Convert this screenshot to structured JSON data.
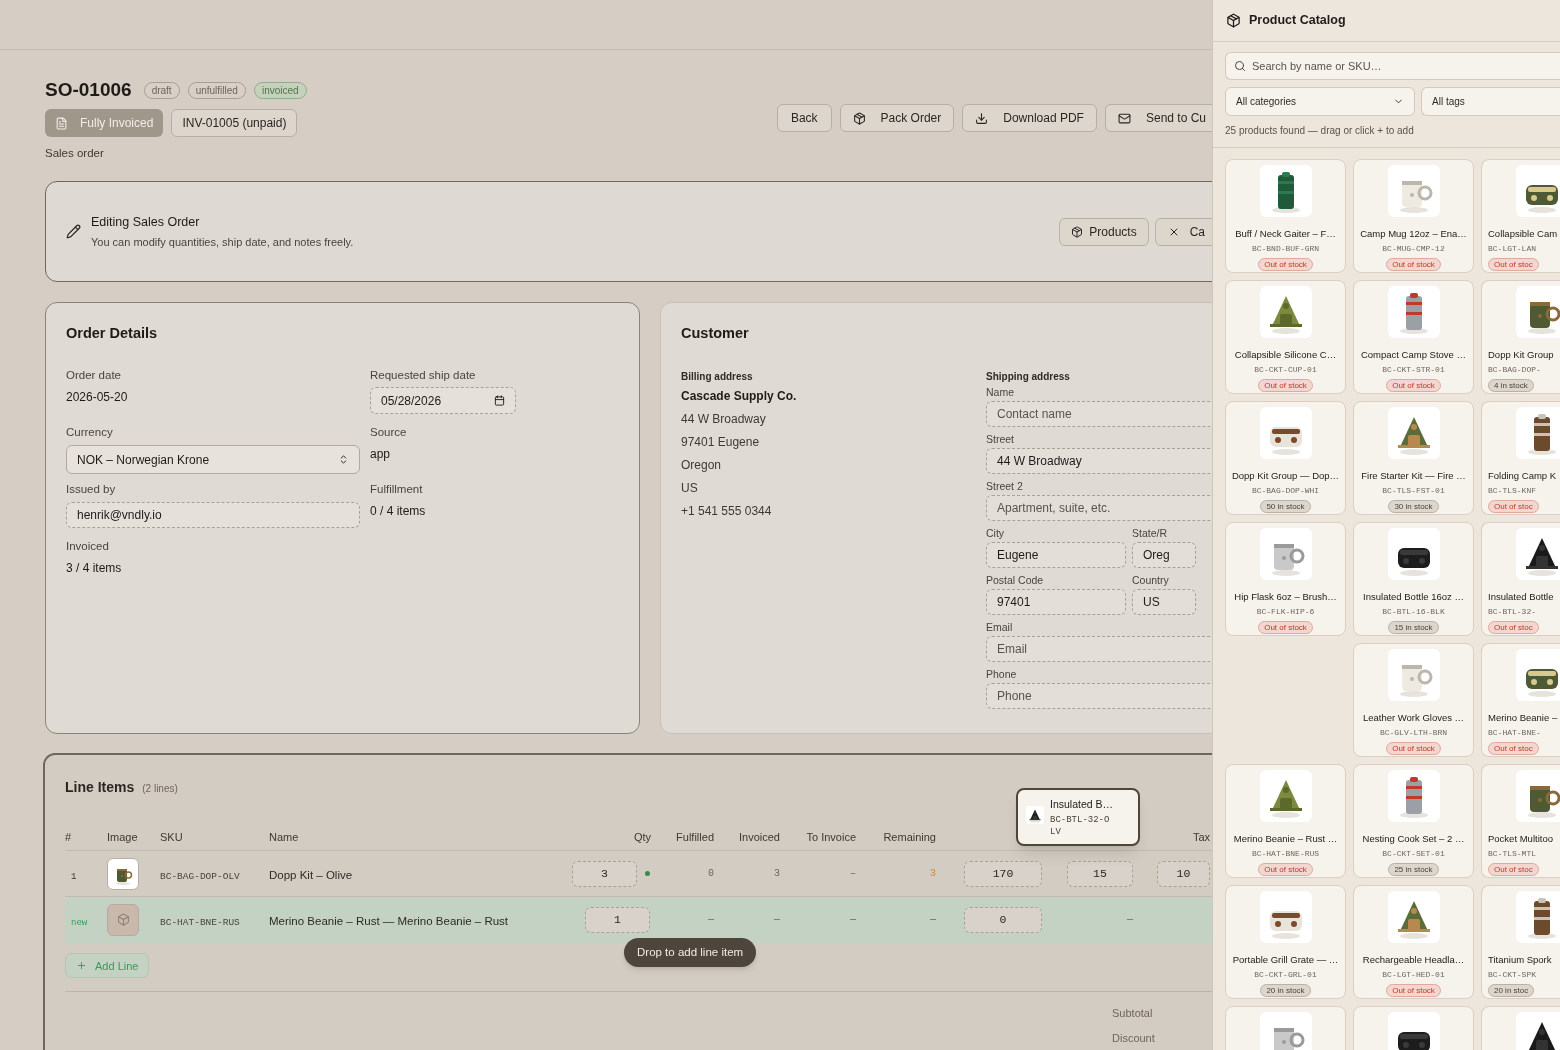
{
  "header": {
    "title": "SO-01006",
    "badges": [
      {
        "label": "draft",
        "kind": "neutral"
      },
      {
        "label": "unfulfilled",
        "kind": "neutral"
      },
      {
        "label": "invoiced",
        "kind": "success"
      }
    ],
    "status_button": "Fully Invoiced",
    "invoice_button": "INV-01005 (unpaid)",
    "subtitle": "Sales order",
    "actions": [
      "Back",
      "Pack Order",
      "Download PDF",
      "Send to Cu"
    ]
  },
  "banner": {
    "title": "Editing Sales Order",
    "text": "You can modify quantities, ship date, and notes freely.",
    "buttons": [
      "Products",
      "Ca"
    ]
  },
  "order_details": {
    "title": "Order Details",
    "fields": [
      {
        "label": "Order date",
        "kind": "text",
        "value": "2026-05-20"
      },
      {
        "label": "Requested ship date",
        "kind": "date",
        "value": "05/28/2026"
      },
      {
        "label": "Currency",
        "kind": "select",
        "value": "NOK – Norwegian Krone"
      },
      {
        "label": "Source",
        "kind": "text",
        "value": "app"
      },
      {
        "label": "Issued by",
        "kind": "input",
        "value": "henrik@vndly.io"
      },
      {
        "label": "Fulfillment",
        "kind": "text",
        "value": "0 / 4 items"
      },
      {
        "label": "Invoiced",
        "kind": "text",
        "value": "3 / 4 items"
      }
    ]
  },
  "customer": {
    "title": "Customer",
    "billing": {
      "label": "Billing address",
      "company": "Cascade Supply Co.",
      "lines": [
        "44 W Broadway",
        "97401 Eugene",
        "Oregon",
        "US",
        "+1 541 555 0344"
      ]
    },
    "shipping": {
      "label": "Shipping address",
      "fields": [
        {
          "label": "Name",
          "placeholder": "Contact name"
        },
        {
          "label": "Street",
          "value": "44 W Broadway"
        },
        {
          "label": "Street 2",
          "placeholder": "Apartment, suite, etc."
        },
        {
          "label": "City",
          "value": "Eugene"
        },
        {
          "label": "State/R",
          "value": "Oreg"
        },
        {
          "label": "Postal Code",
          "value": "97401"
        },
        {
          "label": "Country",
          "value": "US"
        },
        {
          "label": "Email",
          "placeholder": "Email"
        },
        {
          "label": "Phone",
          "placeholder": "Phone"
        }
      ]
    }
  },
  "line_items": {
    "title": "Line Items",
    "count": "(2 lines)",
    "columns": [
      "#",
      "Image",
      "SKU",
      "Name",
      "Qty",
      "Fulfilled",
      "Invoiced",
      "To Invoice",
      "Remaining",
      "Tax"
    ],
    "rows": [
      {
        "kind": "existing",
        "index": "1",
        "sku": "BC-BAG-DOP-OLV",
        "name": "Dopp Kit – Olive",
        "qty": "3",
        "fulfilled": "0",
        "invoiced": "3",
        "to_invoice": "–",
        "remaining": "3",
        "price": "170",
        "discount": "15",
        "tax": "10"
      },
      {
        "kind": "new",
        "index": "new",
        "sku": "BC-HAT-BNE-RUS",
        "name": "Merino Beanie – Rust — Merino Beanie – Rust",
        "qty": "1",
        "fulfilled": "—",
        "invoiced": "—",
        "to_invoice": "—",
        "remaining": "—",
        "price": "0",
        "discount": "—"
      }
    ],
    "add_button": "Add Line",
    "drop_hint": "Drop to add line item",
    "drag_item": {
      "name": "Insulated B…",
      "sku": "BC-BTL-32-OLV"
    },
    "totals": [
      "Subtotal",
      "Discount"
    ]
  },
  "panel": {
    "title": "Product Catalog",
    "search": {
      "placeholder": "Search by name or SKU…"
    },
    "filters": [
      "All categories",
      "All tags"
    ],
    "count": "25 products found — drag or click + to add",
    "products": [
      {
        "kind": "card",
        "name": "Buff / Neck Gaiter – F…",
        "sku": "BC-BND-BUF-GRN",
        "stock": "Out of stock",
        "out": true
      },
      {
        "kind": "card",
        "name": "Camp Mug 12oz – Ena…",
        "sku": "BC-MUG-CMP-12",
        "stock": "Out of stock",
        "out": true
      },
      {
        "kind": "card",
        "name": "Collapsible Cam",
        "sku": "BC-LGT-LAN",
        "stock": "Out of stoc",
        "out": true
      },
      {
        "kind": "card",
        "name": "Collapsible Silicone C…",
        "sku": "BC-CKT-CUP-01",
        "stock": "Out of stock",
        "out": true
      },
      {
        "kind": "card",
        "name": "Compact Camp Stove …",
        "sku": "BC-CKT-STR-01",
        "stock": "Out of stock",
        "out": true
      },
      {
        "kind": "card",
        "name": "Dopp Kit Group",
        "sku": "BC-BAG-DOP-",
        "stock": "4 in stock",
        "out": false
      },
      {
        "kind": "card",
        "name": "Dopp Kit Group — Dop…",
        "sku": "BC-BAG-DOP-WHI",
        "stock": "50 in stock",
        "out": false
      },
      {
        "kind": "card",
        "name": "Fire Starter Kit — Fire …",
        "sku": "BC-TLS-FST-01",
        "stock": "30 in stock",
        "out": false
      },
      {
        "kind": "card",
        "name": "Folding Camp K",
        "sku": "BC-TLS-KNF",
        "stock": "Out of stoc",
        "out": true
      },
      {
        "kind": "card",
        "name": "Hip Flask 6oz – Brush…",
        "sku": "BC-FLK-HIP-6",
        "stock": "Out of stock",
        "out": true
      },
      {
        "kind": "card",
        "name": "Insulated Bottle 16oz …",
        "sku": "BC-BTL-16-BLK",
        "stock": "15 in stock",
        "out": false
      },
      {
        "kind": "card",
        "name": "Insulated Bottle",
        "sku": "BC-BTL-32-",
        "stock": "Out of stoc",
        "out": true
      },
      {
        "kind": "empty"
      },
      {
        "kind": "card",
        "name": "Leather Work Gloves …",
        "sku": "BC-GLV-LTH-BRN",
        "stock": "Out of stock",
        "out": true
      },
      {
        "kind": "card",
        "name": "Merino Beanie –",
        "sku": "BC-HAT-BNE-",
        "stock": "Out of stoc",
        "out": true
      },
      {
        "kind": "card",
        "name": "Merino Beanie – Rust …",
        "sku": "BC-HAT-BNE-RUS",
        "stock": "Out of stock",
        "out": true
      },
      {
        "kind": "card",
        "name": "Nesting Cook Set – 2 …",
        "sku": "BC-CKT-SET-01",
        "stock": "25 in stock",
        "out": false
      },
      {
        "kind": "card",
        "name": "Pocket Multitoo",
        "sku": "BC-TLS-MTL",
        "stock": "Out of stoc",
        "out": true
      },
      {
        "kind": "card",
        "name": "Portable Grill Grate — …",
        "sku": "BC-CKT-GRL-01",
        "stock": "20 in stock",
        "out": false
      },
      {
        "kind": "card",
        "name": "Rechargeable Headla…",
        "sku": "BC-LGT-HED-01",
        "stock": "Out of stock",
        "out": true
      },
      {
        "kind": "card",
        "name": "Titanium Spork",
        "sku": "BC-CKT-SPK",
        "stock": "20 in stoc",
        "out": false
      },
      {
        "kind": "cut"
      },
      {
        "kind": "cut"
      },
      {
        "kind": "cut"
      }
    ]
  }
}
